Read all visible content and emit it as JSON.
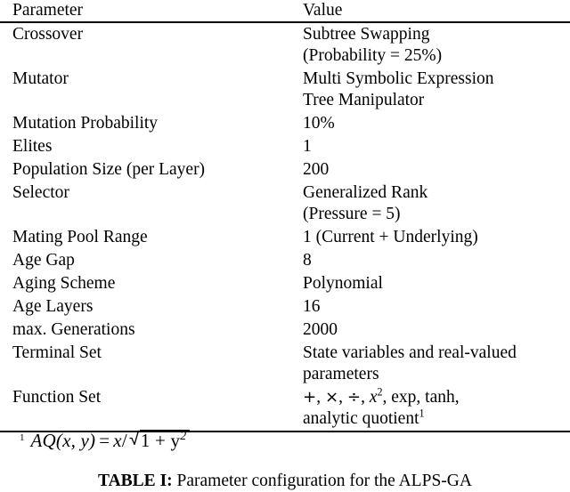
{
  "table": {
    "headers": {
      "parameter": "Parameter",
      "value": "Value"
    },
    "rows": [
      {
        "parameter": "Crossover",
        "value_lines": [
          "Subtree Swapping",
          "(Probability = 25%)"
        ]
      },
      {
        "parameter": "Mutator",
        "value_lines": [
          "Multi Symbolic Expression",
          "Tree Manipulator"
        ]
      },
      {
        "parameter": "Mutation Probability",
        "value_lines": [
          "10%"
        ]
      },
      {
        "parameter": "Elites",
        "value_lines": [
          "1"
        ]
      },
      {
        "parameter": "Population Size (per Layer)",
        "value_lines": [
          "200"
        ]
      },
      {
        "parameter": "Selector",
        "value_lines": [
          "Generalized Rank",
          "(Pressure = 5)"
        ]
      },
      {
        "parameter": "Mating Pool Range",
        "value_lines": [
          "1 (Current + Underlying)"
        ]
      },
      {
        "parameter": "Age Gap",
        "value_lines": [
          "8"
        ]
      },
      {
        "parameter": "Aging Scheme",
        "value_lines": [
          "Polynomial"
        ]
      },
      {
        "parameter": "Age Layers",
        "value_lines": [
          "16"
        ]
      },
      {
        "parameter": "max. Generations",
        "value_lines": [
          "2000"
        ]
      },
      {
        "parameter": "Terminal Set",
        "value_lines": [
          "State variables and real-valued",
          "parameters"
        ]
      },
      {
        "parameter": "Function Set",
        "value_lines": [
          "+, ×, ÷, x², exp, tanh,",
          "analytic quotient¹"
        ]
      }
    ]
  },
  "footnote": {
    "marker": "1",
    "formula_text": "AQ(x, y) = x/√(1 + y²)",
    "lhs": "AQ(x, y)",
    "equals": "=",
    "numerator": "x",
    "slash": "/",
    "radicand": "1 + y",
    "radicand_exponent": "2"
  },
  "caption": {
    "label": "TABLE I:",
    "text": " Parameter configuration for the ALPS-GA"
  }
}
